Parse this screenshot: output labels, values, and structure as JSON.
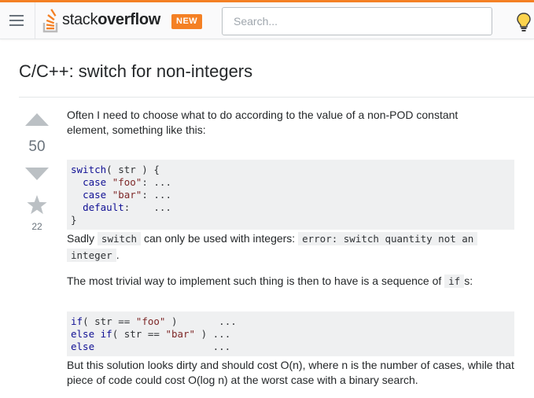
{
  "header": {
    "logo_light": "stack",
    "logo_bold": "overflow",
    "badge": "NEW",
    "search_placeholder": "Search..."
  },
  "question": {
    "title": "C/C++: switch for non-integers",
    "score": "50",
    "favorites": "22",
    "para1": "Often I need to choose what to do according to the value of a non-POD constant element, something like this:",
    "para2_a": "Sadly ",
    "para2_code1": "switch",
    "para2_b": " can only be used with integers: ",
    "para2_code2": "error: switch quantity not an",
    "para2_code3": "integer",
    "para2_c": ".",
    "para3_a": "The most trivial way to implement such thing is then to have is a sequence of ",
    "para3_code": "if",
    "para3_b": "s:",
    "para4": "But this solution looks dirty and should cost O(n), where n is the number of cases, while that piece of code could cost O(log n) at the worst case with a binary search."
  },
  "code1": [
    [
      {
        "t": "switch",
        "c": "kw"
      },
      {
        "t": "( str ) {",
        "c": ""
      }
    ],
    [
      {
        "t": "  ",
        "c": ""
      },
      {
        "t": "case",
        "c": "kw"
      },
      {
        "t": " ",
        "c": ""
      },
      {
        "t": "\"foo\"",
        "c": "str"
      },
      {
        "t": ": ...",
        "c": ""
      }
    ],
    [
      {
        "t": "  ",
        "c": ""
      },
      {
        "t": "case",
        "c": "kw"
      },
      {
        "t": " ",
        "c": ""
      },
      {
        "t": "\"bar\"",
        "c": "str"
      },
      {
        "t": ": ...",
        "c": ""
      }
    ],
    [
      {
        "t": "  ",
        "c": ""
      },
      {
        "t": "default",
        "c": "kw"
      },
      {
        "t": ":    ...",
        "c": ""
      }
    ],
    [
      {
        "t": "}",
        "c": ""
      }
    ]
  ],
  "code2": [
    [
      {
        "t": "if",
        "c": "kw"
      },
      {
        "t": "( str == ",
        "c": ""
      },
      {
        "t": "\"foo\"",
        "c": "str"
      },
      {
        "t": " )       ...",
        "c": ""
      }
    ],
    [
      {
        "t": "else",
        "c": "kw"
      },
      {
        "t": " ",
        "c": ""
      },
      {
        "t": "if",
        "c": "kw"
      },
      {
        "t": "( str == ",
        "c": ""
      },
      {
        "t": "\"bar\"",
        "c": "str"
      },
      {
        "t": " ) ...",
        "c": ""
      }
    ],
    [
      {
        "t": "else",
        "c": "kw"
      },
      {
        "t": "                    ...",
        "c": ""
      }
    ]
  ],
  "colors": {
    "accent": "#f48024",
    "keyword": "#101094",
    "string": "#7d2727"
  }
}
